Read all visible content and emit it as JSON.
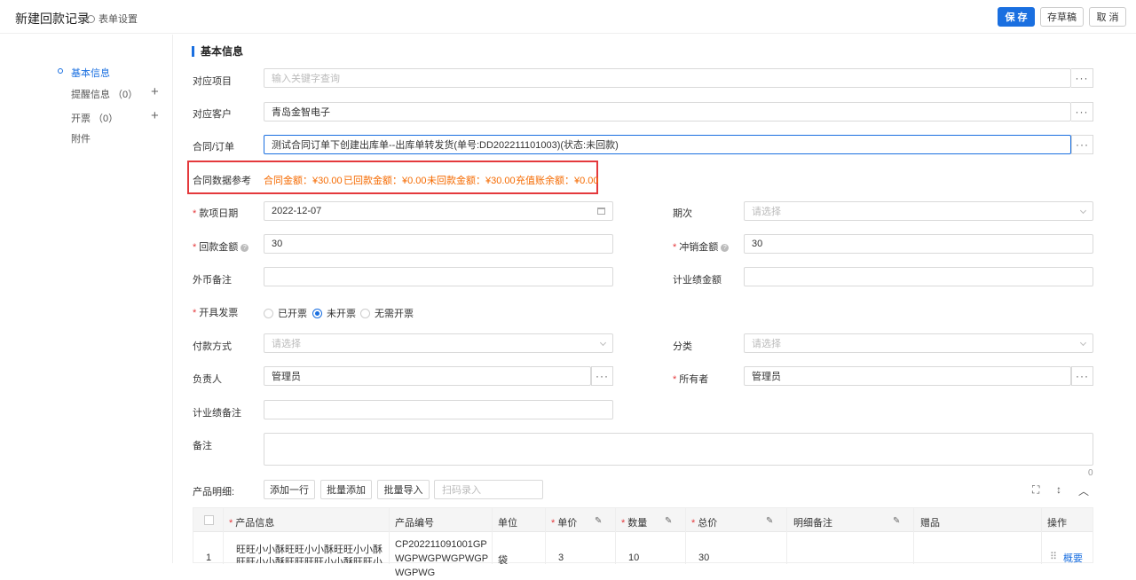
{
  "header": {
    "title": "新建回款记录",
    "form_settings": "表单设置",
    "save": "保 存",
    "save_draft": "存草稿",
    "cancel": "取 消"
  },
  "sidebar": {
    "items": [
      {
        "label": "基本信息"
      },
      {
        "label": "提醒信息 （0）"
      },
      {
        "label": "开票 （0）"
      },
      {
        "label": "附件"
      }
    ]
  },
  "section_title": "基本信息",
  "form": {
    "project_label": "对应项目",
    "project_placeholder": "输入关键字查询",
    "customer_label": "对应客户",
    "customer_value": "青岛金智电子",
    "contract_label": "合同/订单",
    "contract_value": "测试合同订单下创建出库单--出库单转发货(单号:DD202211101003)(状态:未回款)",
    "ref_label": "合同数据参考",
    "ref_contract": "合同金额：¥30.00",
    "ref_received": "已回款金额：¥0.00",
    "ref_unreceived": "未回款金额：¥30.00",
    "ref_recharge": "充值账余额：¥0.00",
    "date_label": "款项日期",
    "date_value": "2022-12-07",
    "period_label": "期次",
    "period_placeholder": "请选择",
    "amount_label": "回款金额",
    "amount_value": "30",
    "offset_label": "冲销金额",
    "offset_value": "30",
    "fx_label": "外币备注",
    "perf_amount_label": "计业绩金额",
    "invoice_label": "开具发票",
    "invoice_opts": [
      "已开票",
      "未开票",
      "无需开票"
    ],
    "pay_label": "付款方式",
    "pay_placeholder": "请选择",
    "category_label": "分类",
    "category_placeholder": "请选择",
    "owner_label": "负责人",
    "owner_value": "管理员",
    "holder_label": "所有者",
    "holder_value": "管理员",
    "perf_note_label": "计业绩备注",
    "note_label": "备注",
    "note_count": "0",
    "required_mark": "*",
    "dots": "···",
    "help": "?"
  },
  "products": {
    "label": "产品明细:",
    "add_row": "添加一行",
    "batch_add": "批量添加",
    "batch_import": "批量导入",
    "scan_placeholder": "扫码录入",
    "columns": [
      "产品信息",
      "产品编号",
      "单位",
      "单价",
      "数量",
      "总价",
      "明细备注",
      "赠品",
      "操作"
    ],
    "rows": [
      {
        "index": "1",
        "info": "旺旺小小酥旺旺小小酥旺旺小小酥旺旺小小酥旺旺旺旺小小酥旺旺小小",
        "code": "CP202211091001GPWGPWGPWGPWGPWGPWG",
        "unit": "袋",
        "price": "3",
        "qty": "10",
        "total": "30",
        "action": "概要"
      }
    ]
  }
}
